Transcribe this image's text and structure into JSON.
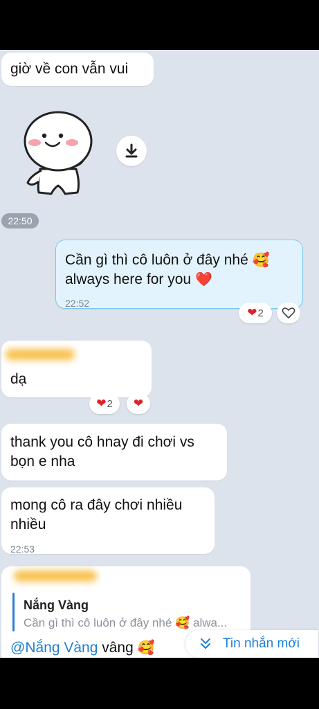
{
  "messages": {
    "m1_text": "giờ về con vẫn vui",
    "sticker_time": "22:50",
    "m2_line1": "Cần gì thì cô luôn ở đây nhé",
    "m2_line2": "always here for you",
    "m2_time": "22:52",
    "m2_react_count": "2",
    "m3_text": "dạ",
    "m3_react_count": "2",
    "m4_line1": "thank you cô hnay đi chơi vs",
    "m4_line2": "bọn e nha",
    "m5_line1": "mong cô ra đây chơi nhiều",
    "m5_line2": "nhiều",
    "m5_time": "22:53",
    "m6_quote_author": "Nắng Vàng",
    "m6_quote_text": "Cần gì thì cô luôn ở đây nhé",
    "m6_quote_suffix": "alwa...",
    "m6_mention": "@Nắng Vàng",
    "m6_text": "vâng"
  },
  "new_messages_button": "Tin nhắn mới",
  "emoji": {
    "smiling_hearts": "🥰",
    "red_heart": "❤️",
    "heart": "❤"
  },
  "colors": {
    "chat_bg": "#dde3ed",
    "own_bubble": "#e3f3fd",
    "own_border": "#7cc7ec",
    "accent_blue": "#1e7fd6",
    "heart_red": "#e0212b"
  }
}
